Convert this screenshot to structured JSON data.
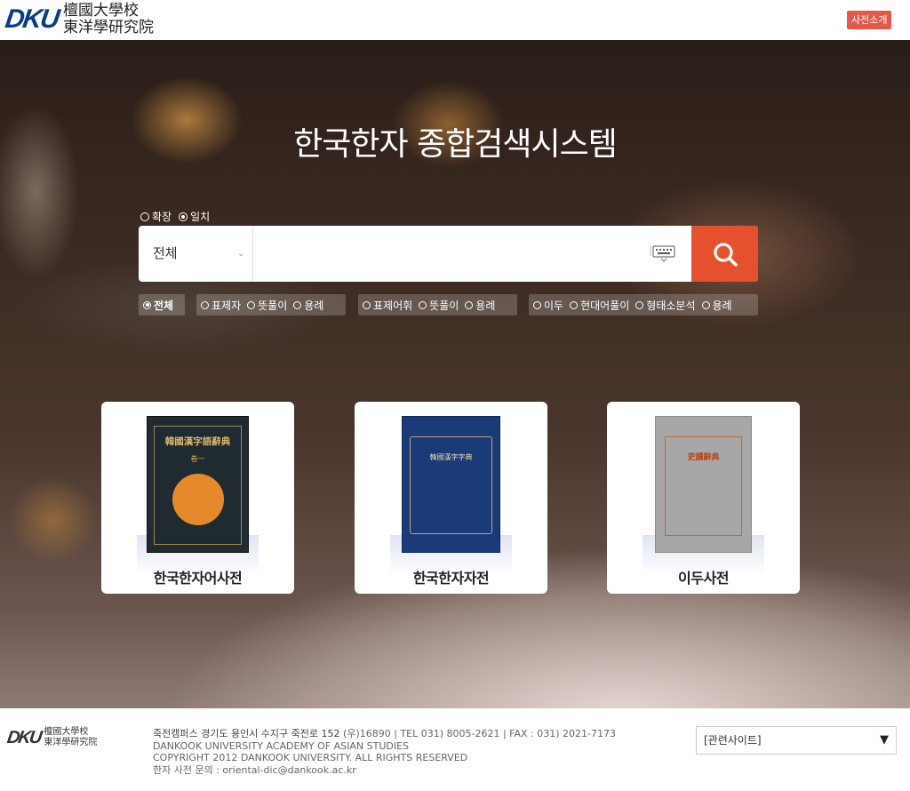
{
  "header": {
    "logo_dku": "DKU",
    "logo_line1": "檀國大學校",
    "logo_line2": "東洋學研究院",
    "intro_button": "사전소개"
  },
  "hero": {
    "title": "한국한자 종합검색시스템",
    "mode_options": [
      {
        "label": "확장",
        "selected": false
      },
      {
        "label": "일치",
        "selected": true
      }
    ],
    "scope_select_value": "전체",
    "search_input_value": "",
    "filters": {
      "all": {
        "label": "전체",
        "selected": true
      },
      "group1": [
        "표제자",
        "뜻풀이",
        "용례"
      ],
      "group2": [
        "표제어휘",
        "뜻풀이",
        "용례"
      ],
      "group3": [
        "이두",
        "현대어풀이",
        "형태소분석",
        "용례"
      ]
    }
  },
  "cards": [
    {
      "label": "한국한자어사전",
      "book_title": "韓國漢字語辭典",
      "book_volume": "卷一"
    },
    {
      "label": "한국한자자전",
      "book_title": "韓國漢字字典"
    },
    {
      "label": "이두사전",
      "book_title": "吏讀辭典"
    }
  ],
  "footer": {
    "logo_dku": "DKU",
    "logo_line1": "檀國大學校",
    "logo_line2": "東洋學研究院",
    "address_strong": "죽전캠퍼스 경기도 용인시 수지구 죽전로 152",
    "address_rest": " (우)16890 | TEL 031) 8005-2621 | FAX : 031) 2021-7173",
    "line2": "DANKOOK UNIVERSITY ACADEMY OF ASIAN STUDIES",
    "line3": "COPYRIGHT 2012 DANKOOK UNIVERSITY. ALL RIGHTS RESERVED",
    "line4": "한자 사전 문의 : oriental-dic@dankook.ac.kr",
    "related_select": "[관련사이트]"
  },
  "colors": {
    "accent": "#e5512f",
    "intro_button": "#e45a4a",
    "logo_blue": "#0b3c8c"
  },
  "icons": [
    "keyboard-icon",
    "search-icon",
    "chevron-down-icon",
    "dropdown-arrow-icon"
  ]
}
